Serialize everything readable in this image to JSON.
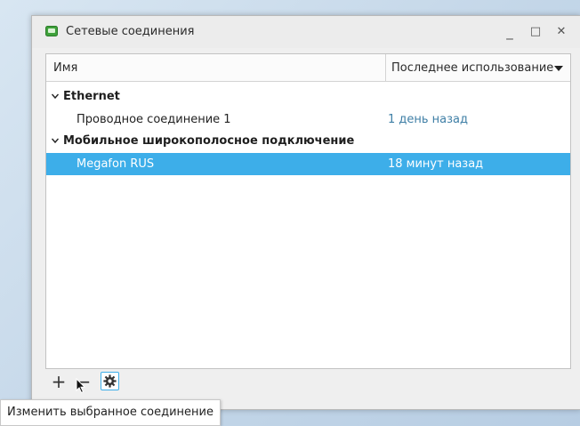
{
  "window": {
    "title": "Сетевые соединения",
    "minimize_label": "_",
    "maximize_label": "□",
    "close_label": "✕"
  },
  "columns": {
    "name": "Имя",
    "last_used": "Последнее использование"
  },
  "groups": [
    {
      "label": "Ethernet",
      "connections": [
        {
          "name": "Проводное соединение 1",
          "last_used": "1 день назад",
          "selected": false
        }
      ]
    },
    {
      "label": "Мобильное широкополосное подключение",
      "connections": [
        {
          "name": "Megafon RUS",
          "last_used": "18 минут назад",
          "selected": true
        }
      ]
    }
  ],
  "toolbar": {
    "add_label": "+",
    "remove_label": "−",
    "edit_icon": "gear-icon"
  },
  "tooltip": {
    "text": "Изменить выбранное соединение"
  },
  "colors": {
    "selection": "#3daee9",
    "time_text": "#3f7fa6",
    "app_icon": "#3ea13b"
  }
}
